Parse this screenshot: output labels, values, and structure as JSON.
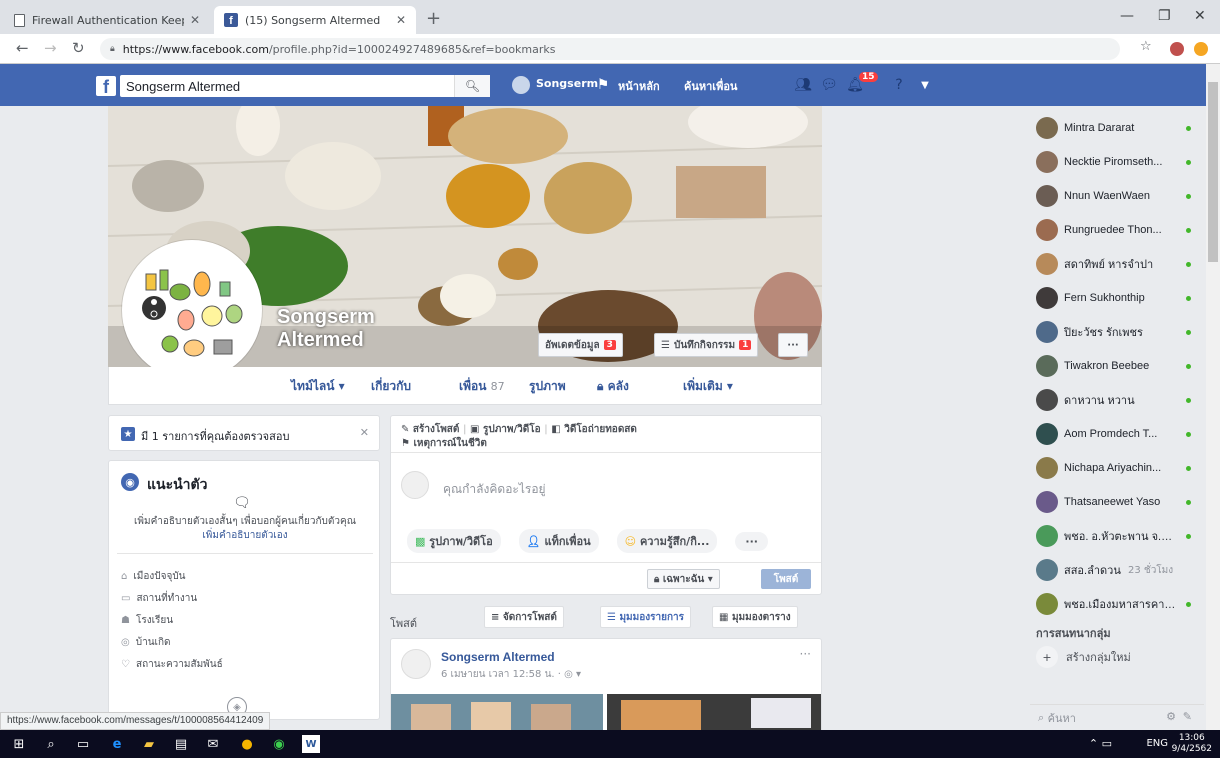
{
  "browser": {
    "tabs": [
      {
        "title": "Firewall Authentication Keepalive"
      },
      {
        "title": "(15) Songserm Altermed"
      }
    ],
    "url_host": "https://www.facebook.com",
    "url_path": "/profile.php?id=100024927489685&ref=bookmarks"
  },
  "fbbar": {
    "search_value": "Songserm Altermed",
    "profile_name": "Songserm",
    "home": "หน้าหลัก",
    "find_friends": "ค้นหาเพื่อน",
    "notif_count": "15"
  },
  "profile": {
    "name_line1": "Songserm",
    "name_line2": "Altermed",
    "update_info": "อัพเดตข้อมูล",
    "update_count": "3",
    "activity_log": "บันทึกกิจกรรม",
    "activity_count": "1",
    "more_dots": "···",
    "tabs": [
      {
        "label": "ไทม์ไลน์ ▾"
      },
      {
        "label": "เกี่ยวกับ"
      },
      {
        "label": "เพื่อน",
        "count": "87"
      },
      {
        "label": "รูปภาพ"
      },
      {
        "label": "คลัง"
      },
      {
        "label": "เพิ่มเติม ▾"
      }
    ]
  },
  "left": {
    "review_text": "มี 1 รายการที่คุณต้องตรวจสอบ",
    "intro_title": "แนะนำตัว",
    "intro_desc": "เพิ่มคำอธิบายตัวเองสั้นๆ เพื่อบอกผู้คนเกี่ยวกับตัวคุณ",
    "intro_link": "เพิ่มคำอธิบายตัวเอง",
    "intro_items": [
      {
        "icon": "home-icon",
        "label": "เมืองปัจจุบัน"
      },
      {
        "icon": "briefcase-icon",
        "label": "สถานที่ทำงาน"
      },
      {
        "icon": "graduation-cap-icon",
        "label": "โรงเรียน"
      },
      {
        "icon": "location-pin-icon",
        "label": "บ้านเกิด"
      },
      {
        "icon": "heart-icon",
        "label": "สถานะความสัมพันธ์"
      }
    ]
  },
  "composer": {
    "create_post": "สร้างโพสต์",
    "photo_video": "รูปภาพ/วิดีโอ",
    "live_video": "วิดีโอถ่ายทอดสด",
    "life_event": "เหตุการณ์ในชีวิต",
    "placeholder": "คุณกำลังคิดอะไรอยู่",
    "btn_photo": "รูปภาพ/วิดีโอ",
    "btn_tag": "แท็กเพื่อน",
    "btn_feeling": "ความรู้สึก/กิ...",
    "btn_more": "···",
    "privacy": "เฉพาะฉัน ▾",
    "post_btn": "โพสต์"
  },
  "posts": {
    "label": "โพสต์",
    "manage": "จัดการโพสต์",
    "list_view": "มุมมองรายการ",
    "grid_view": "มุมมองตาราง",
    "author": "Songserm Altermed",
    "time": "6 เมษายน เวลา 12:58 น. · ◎ ▾",
    "more": "···"
  },
  "chat": {
    "friends": [
      {
        "name": "Mintra Dararat",
        "color": "#7a6a4f"
      },
      {
        "name": "Necktie Piromseth...",
        "color": "#8a6f5c"
      },
      {
        "name": "Nnun WaenWaen",
        "color": "#6b5d54"
      },
      {
        "name": "Rungruedee Thon...",
        "color": "#9b6b50"
      },
      {
        "name": "สดาทิพย์ หารจำปา",
        "color": "#b78a5a"
      },
      {
        "name": "Fern Sukhonthip",
        "color": "#3f3a3a"
      },
      {
        "name": "ปิยะวัชร รักเพชร",
        "color": "#4f6a8a"
      },
      {
        "name": "Tiwakron Beebee",
        "color": "#5a6b5a"
      },
      {
        "name": "ดาหวาน หวาน",
        "color": "#4a4a4a"
      },
      {
        "name": "Aom Promdech T...",
        "color": "#2f4f4f"
      },
      {
        "name": "Nichapa Ariyachin...",
        "color": "#8a7a4a"
      },
      {
        "name": "Thatsaneewet Yaso",
        "color": "#6a5a8a"
      },
      {
        "name": "พชอ. อ.หัวตะพาน จ.อำน...",
        "color": "#4a9a5a"
      },
      {
        "name": "สสอ.ลำดวน",
        "ago": "23 ชั่วโมง",
        "color": "#5a7a8a"
      },
      {
        "name": "พชอ.เมืองมหาสารคาม จ...",
        "color": "#7a8a3a"
      }
    ],
    "groups_label": "การสนทนากลุ่ม",
    "create_group": "สร้างกลุ่มใหม่",
    "search_placeholder": "ค้นหา"
  },
  "status_url": "https://www.facebook.com/messages/t/100008564412409",
  "taskbar": {
    "lang": "ENG",
    "time": "13:06",
    "date": "9/4/2562"
  }
}
